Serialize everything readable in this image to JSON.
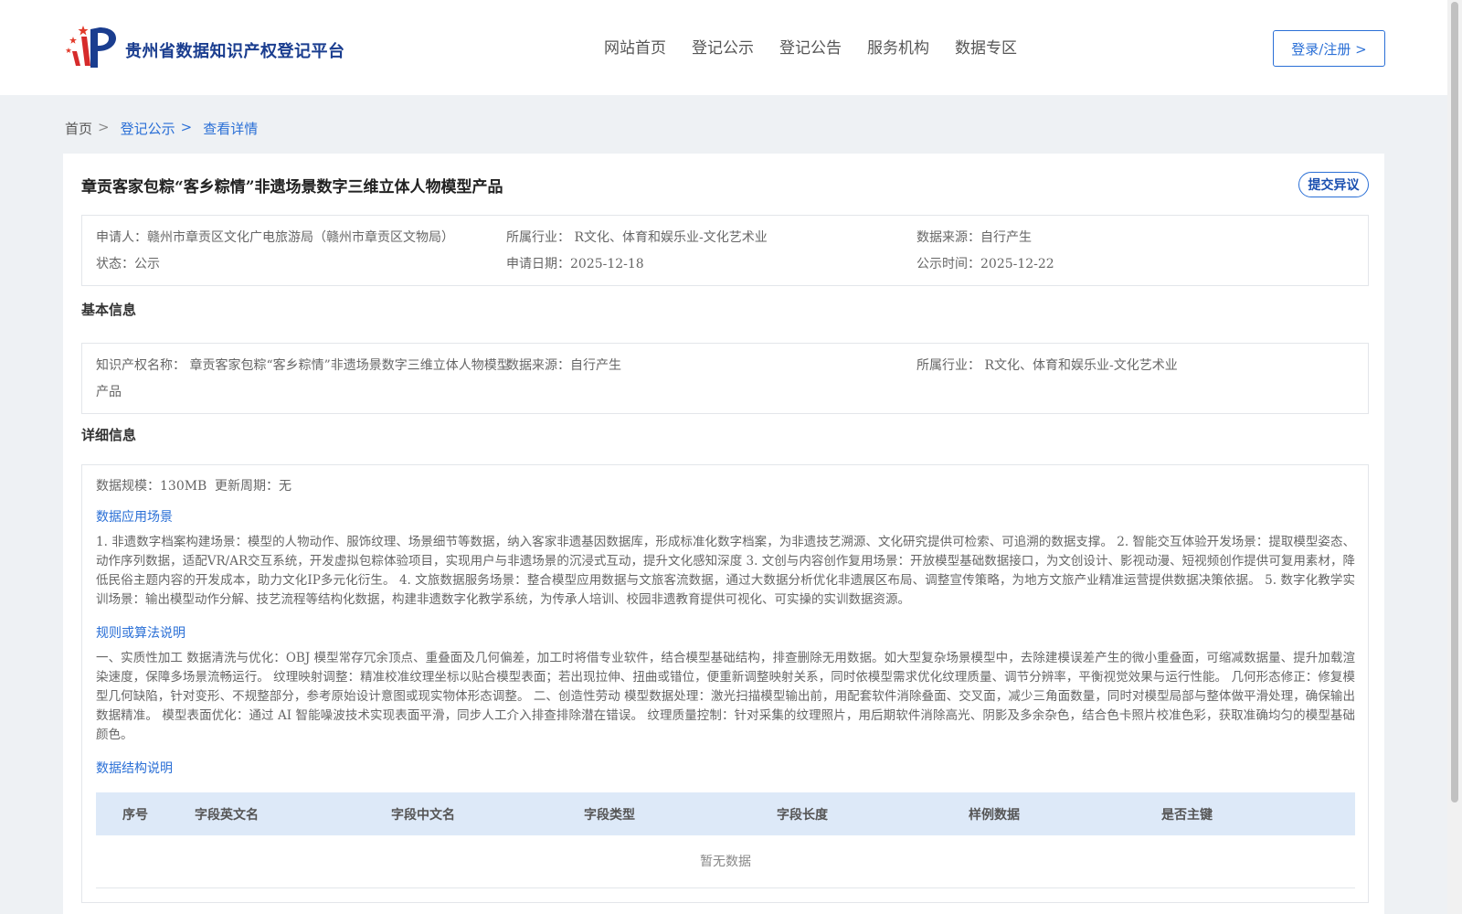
{
  "header": {
    "site_title": "贵州省数据知识产权登记平台",
    "nav": [
      "网站首页",
      "登记公示",
      "登记公告",
      "服务机构",
      "数据专区"
    ],
    "login_label": "登录/注册 >"
  },
  "breadcrumb": {
    "home": "首页",
    "sep": ">",
    "items": [
      "登记公示",
      "查看详情"
    ]
  },
  "record": {
    "title": "章贡客家包粽“客乡粽情”非遗场景数字三维立体人物模型产品",
    "objection_label": "提交异议",
    "summary": {
      "applicant": "申请人：赣州市章贡区文化广电旅游局（赣州市章贡区文物局）",
      "industry": "所属行业：  R文化、体育和娱乐业-文化艺术业",
      "source": "数据来源：自行产生",
      "status": "状态：公示",
      "apply_date": "申请日期：2025-12-18",
      "publish_date": "公示时间：2025-12-22"
    }
  },
  "basic": {
    "section_title": "基本信息",
    "ip_name_line1": "知识产权名称：  章贡客家包粽“客乡粽情”非遗场景数字三维立体人物模型",
    "ip_name_line2": "产品",
    "source": "数据来源：自行产生",
    "industry": "所属行业：  R文化、体育和娱乐业-文化艺术业"
  },
  "detail": {
    "section_title": "详细信息",
    "scale": "数据规模：130MB",
    "update_cycle": "更新周期：无",
    "scenario_title": "数据应用场景",
    "scenario_text": "1. 非遗数字档案构建场景：模型的人物动作、服饰纹理、场景细节等数据，纳入客家非遗基因数据库，形成标准化数字档案，为非遗技艺溯源、文化研究提供可检索、可追溯的数据支撑。 2. 智能交互体验开发场景：提取模型姿态、动作序列数据，适配VR/AR交互系统，开发虚拟包粽体验项目，实现用户与非遗场景的沉浸式互动，提升文化感知深度 3. 文创与内容创作复用场景：开放模型基础数据接口，为文创设计、影视动漫、短视频创作提供可复用素材，降低民俗主题内容的开发成本，助力文化IP多元化衍生。 4. 文旅数据服务场景：整合模型应用数据与文旅客流数据，通过大数据分析优化非遗展区布局、调整宣传策略，为地方文旅产业精准运营提供数据决策依据。 5. 数字化教学实训场景：输出模型动作分解、技艺流程等结构化数据，构建非遗数字化教学系统，为传承人培训、校园非遗教育提供可视化、可实操的实训数据资源。",
    "rules_title": "规则或算法说明",
    "rules_text": "一、实质性加工 数据清洗与优化：OBJ 模型常存冗余顶点、重叠面及几何偏差，加工时将借专业软件，结合模型基础结构，排查删除无用数据。如大型复杂场景模型中，去除建模误差产生的微小重叠面，可缩减数据量、提升加载渲染速度，保障多场景流畅运行。 纹理映射调整：精准校准纹理坐标以贴合模型表面；若出现拉伸、扭曲或错位，便重新调整映射关系，同时依模型需求优化纹理质量、调节分辨率，平衡视觉效果与运行性能。 几何形态修正：修复模型几何缺陷，针对变形、不规整部分，参考原始设计意图或现实物体形态调整。 二、创造性劳动 模型数据处理：激光扫描模型输出前，用配套软件消除叠面、交叉面，减少三角面数量，同时对模型局部与整体做平滑处理，确保输出数据精准。 模型表面优化：通过 AI 智能噪波技术实现表面平滑，同步人工介入排查排除潜在错误。 纹理质量控制：针对采集的纹理照片，用后期软件消除高光、阴影及多余杂色，结合色卡照片校准色彩，获取准确均匀的模型基础颜色。",
    "structure_title": "数据结构说明",
    "table_headers": [
      "序号",
      "字段英文名",
      "字段中文名",
      "字段类型",
      "字段长度",
      "样例数据",
      "是否主键"
    ],
    "empty_text": "暂无数据"
  }
}
